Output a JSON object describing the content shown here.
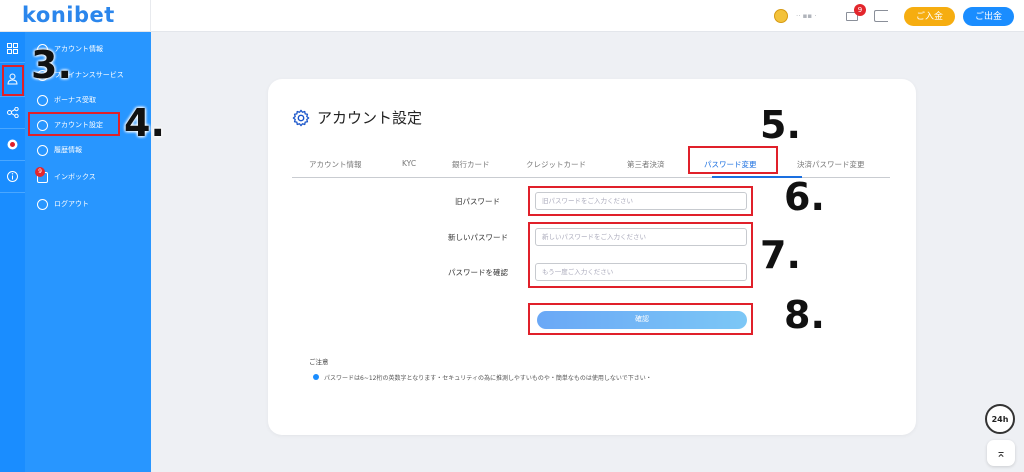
{
  "header": {
    "logo": "konibet",
    "username": "·· ▪▪ ·",
    "mail_badge": "9",
    "deposit_label": "ご入金",
    "withdraw_label": "ご出金"
  },
  "sidebar": {
    "items": [
      {
        "label": "アカウント情報"
      },
      {
        "label": "ファイナンスサービス"
      },
      {
        "label": "ボーナス受取"
      },
      {
        "label": "アカウント設定"
      },
      {
        "label": "履歴情報"
      },
      {
        "label": "インボックス",
        "badge": "9"
      },
      {
        "label": "ログアウト"
      }
    ]
  },
  "card": {
    "title": "アカウント設定",
    "tabs": [
      {
        "label": "アカウント情報"
      },
      {
        "label": "KYC"
      },
      {
        "label": "銀行カード"
      },
      {
        "label": "クレジットカード"
      },
      {
        "label": "第三者決済"
      },
      {
        "label": "パスワード変更",
        "active": true
      },
      {
        "label": "決済パスワード変更"
      }
    ],
    "form": {
      "old_password_label": "旧パスワード",
      "old_password_placeholder": "旧パスワードをご入力ください",
      "new_password_label": "新しいパスワード",
      "new_password_placeholder": "新しいパスワードをご入力ください",
      "confirm_password_label": "パスワードを確認",
      "confirm_password_placeholder": "もう一度ご入力ください",
      "submit_label": "確認"
    },
    "notes_title": "ご注意",
    "notes": [
      "パスワードは6~12桁の英数字となります・セキュリティの為に推測しやすいものや・簡単なものは使用しないで下さい・"
    ]
  },
  "annotations": [
    "3.",
    "4.",
    "5.",
    "6.",
    "7.",
    "8."
  ],
  "support_label": "24h",
  "to_top_label": "⌅",
  "colors": {
    "brand_blue": "#1a8dff",
    "deposit_orange": "#f6ad10",
    "annotation_red": "#e0202a",
    "active_tab": "#1a6fe0"
  }
}
